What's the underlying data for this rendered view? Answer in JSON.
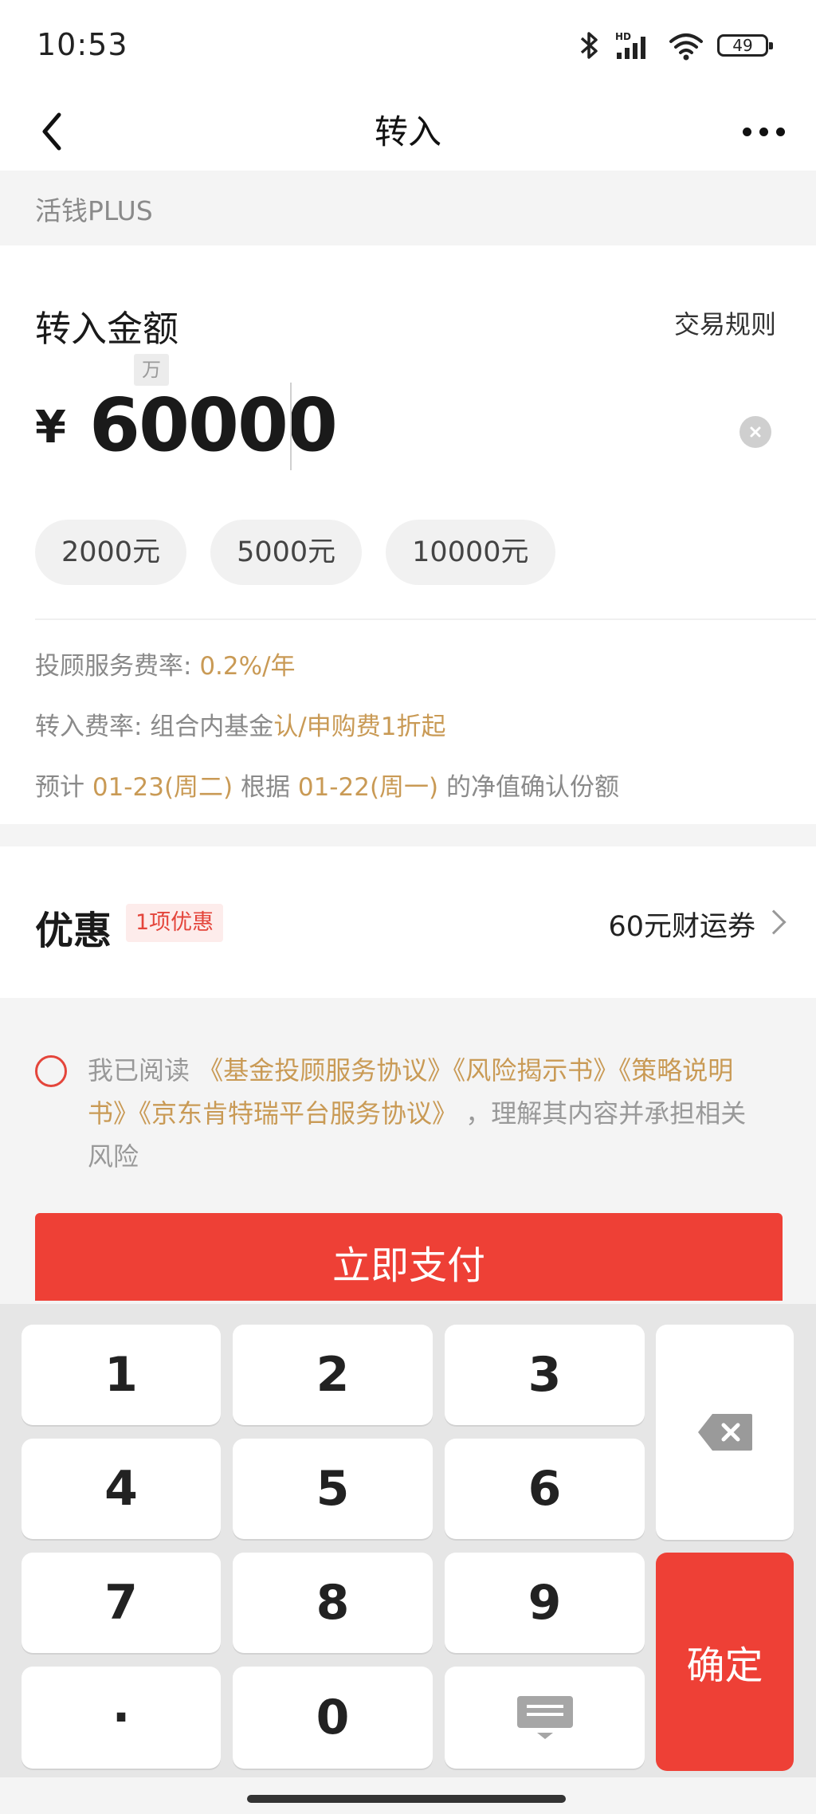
{
  "status_bar": {
    "time": "10:53",
    "battery": "49",
    "icons": [
      "bluetooth-icon",
      "hd-signal-icon",
      "wifi-icon",
      "battery-icon"
    ]
  },
  "nav": {
    "title": "转入"
  },
  "product": {
    "name": "活钱PLUS"
  },
  "amount": {
    "title": "转入金额",
    "rules_link": "交易规则",
    "unit_hint": "万",
    "currency": "¥",
    "value": "60000",
    "quick_amounts": [
      "2000元",
      "5000元",
      "10000元"
    ]
  },
  "info": {
    "fee_label": "投顾服务费率: ",
    "fee_value": "0.2%/年",
    "transfer_label": "转入费率: 组合内基金",
    "transfer_value": "认/申购费1折起",
    "estimate_prefix": "预计 ",
    "confirm_date": "01-23(周二)",
    "estimate_middle": " 根据 ",
    "nav_date": "01-22(周一)",
    "estimate_suffix": " 的净值确认份额"
  },
  "promo": {
    "title": "优惠",
    "badge": "1项优惠",
    "value": "60元财运券"
  },
  "agreement": {
    "prefix": "我已阅读 ",
    "doc1": "《基金投顾服务协议》",
    "doc2": "《风险揭示书》",
    "doc3": "《策略说明书》",
    "doc4": "《京东肯特瑞平台服务协议》",
    "suffix": " ，理解其内容并承担相关风险"
  },
  "pay_button": "立即支付",
  "keypad": {
    "keys": [
      "1",
      "2",
      "3",
      "4",
      "5",
      "6",
      "7",
      "8",
      "9",
      "·",
      "0"
    ],
    "confirm": "确定",
    "backspace_icon": "backspace-icon",
    "hide_keyboard_icon": "hide-keyboard-icon"
  },
  "colors": {
    "accent": "#ee4036",
    "gold": "#c99a55",
    "muted": "#8a8a8a"
  }
}
